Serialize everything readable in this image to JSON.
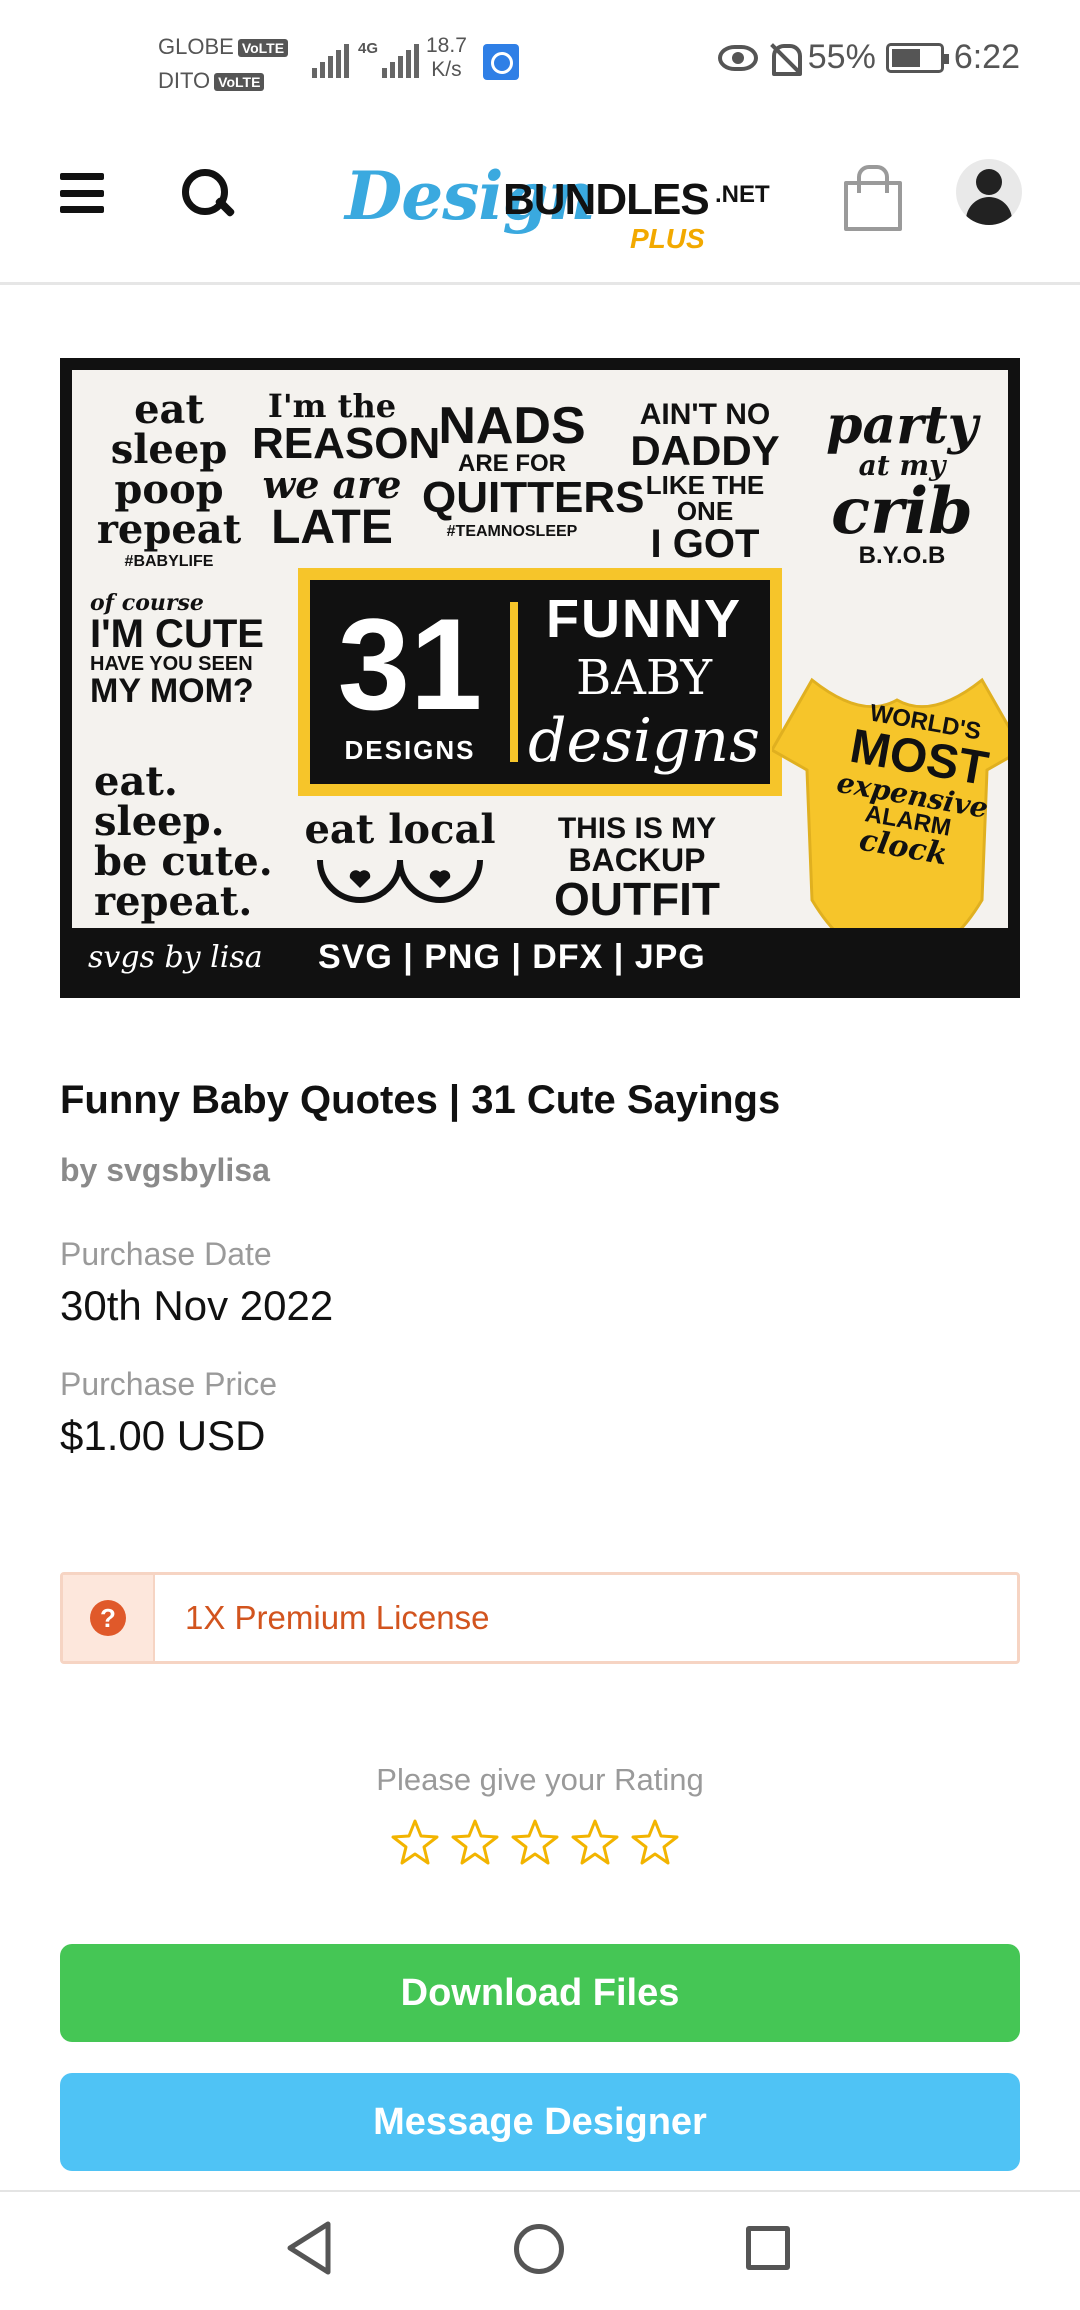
{
  "status_bar": {
    "carrier1": "GLOBE",
    "carrier2": "DITO",
    "volte": "VoLTE",
    "net_type": "4G",
    "speed_value": "18.7",
    "speed_unit": "K/s",
    "battery": "55%",
    "time": "6:22"
  },
  "header": {
    "logo_part1": "Design",
    "logo_part2": "BUNDLES",
    "logo_part3": ".NET",
    "logo_part4": "PLUS"
  },
  "product_image": {
    "q1": [
      "eat",
      "sleep",
      "poop",
      "repeat",
      "#BABYLIFE"
    ],
    "q2": [
      "I'm the",
      "REASON",
      "we are",
      "LATE"
    ],
    "q3": [
      "NADS",
      "ARE FOR",
      "QUITTERS",
      "#TEAMNOSLEEP"
    ],
    "q4": [
      "AIN'T NO",
      "DADDY",
      "LIKE THE ONE",
      "I GOT"
    ],
    "q5": [
      "party",
      "at my",
      "crib",
      "B.Y.O.B"
    ],
    "q6": [
      "of course",
      "I'M CUTE",
      "HAVE YOU SEEN",
      "MY MOM?"
    ],
    "q7": [
      "eat.",
      "sleep.",
      "be cute.",
      "repeat."
    ],
    "q8": [
      "eat local"
    ],
    "q9": [
      "THIS IS MY",
      "BACKUP",
      "OUTFIT"
    ],
    "q10": [
      "WORLD'S",
      "MOST",
      "expensive",
      "ALARM",
      "clock"
    ],
    "count": "31",
    "count_label": "DESIGNS",
    "title_l1": "FUNNY",
    "title_l2": "BABY",
    "title_l3": "designs",
    "signature": "svgs by lisa",
    "formats": "SVG | PNG | DFX | JPG",
    "onesie_color": "#f6c52a"
  },
  "product": {
    "title": "Funny Baby Quotes | 31 Cute Sayings",
    "author": "by svgsbylisa",
    "purchase_date_label": "Purchase Date",
    "purchase_date": "30th Nov 2022",
    "purchase_price_label": "Purchase Price",
    "purchase_price": "$1.00 USD"
  },
  "license": {
    "label": "1X Premium License",
    "icon": "help-icon"
  },
  "rating": {
    "prompt": "Please give your Rating",
    "current": 0,
    "max": 5
  },
  "actions": {
    "download": "Download Files",
    "message": "Message Designer"
  },
  "colors": {
    "download": "#45c655",
    "message": "#4fc3f5",
    "license_accent": "#d2541e",
    "star": "#f2b400",
    "brand_blue": "#3aa9df",
    "brand_yellow": "#f2a900"
  }
}
